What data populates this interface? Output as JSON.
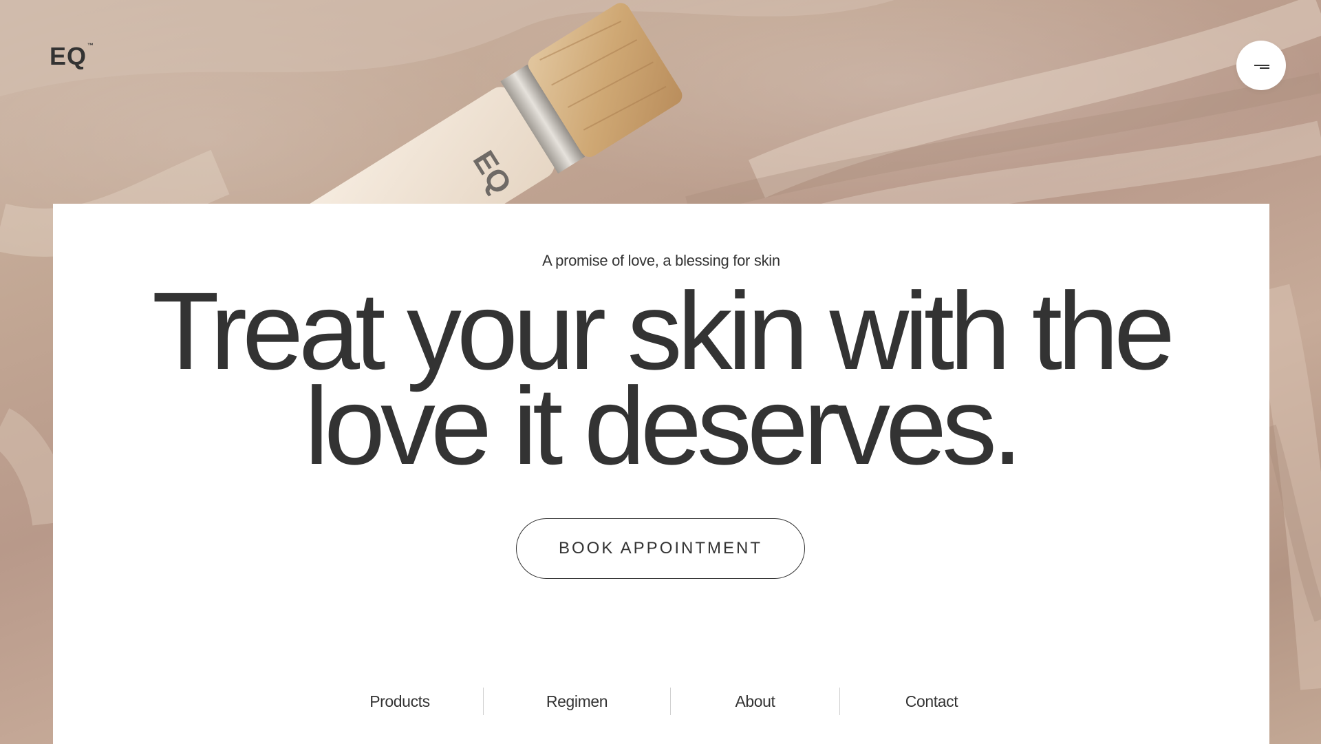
{
  "header": {
    "logo_text": "EQ",
    "logo_mark": "™",
    "menu_icon": "hamburger-menu-icon"
  },
  "hero": {
    "eyebrow": "A promise of love, a blessing for skin",
    "headline_line1": "Treat your skin with the",
    "headline_line2": "love it deserves.",
    "cta_label": "BOOK APPOINTMENT"
  },
  "nav": {
    "items": [
      {
        "label": "Products"
      },
      {
        "label": "Regimen"
      },
      {
        "label": "About"
      },
      {
        "label": "Contact"
      }
    ]
  },
  "background_image": {
    "product_label": "EQ"
  },
  "colors": {
    "text": "#333333",
    "card": "#ffffff",
    "background": "#c2a794",
    "divider": "#cfcfcf"
  }
}
